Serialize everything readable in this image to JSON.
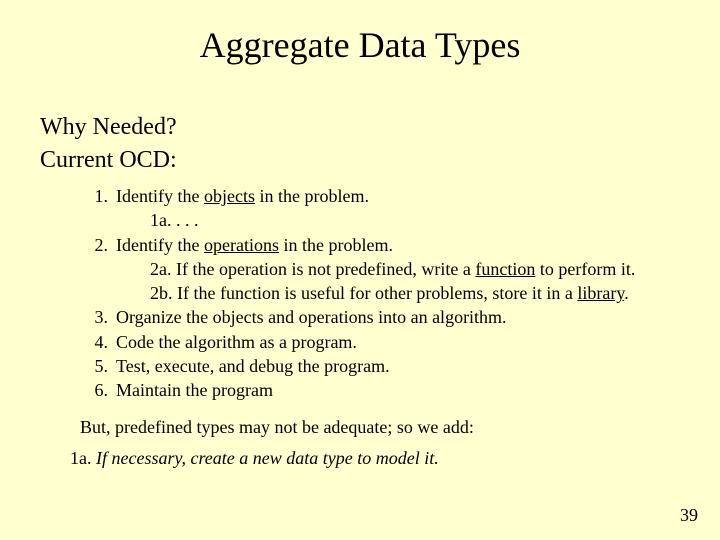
{
  "title": "Aggregate Data Types",
  "heading1": "Why Needed?",
  "heading2": "Current OCD:",
  "list": {
    "n1": "1.",
    "t1a": "Identify the ",
    "t1b_ul": "objects",
    "t1c": " in the problem.",
    "s1a": "1a.   .  .  .",
    "n2": "2.",
    "t2a": "Identify the ",
    "t2b_ul": "operations",
    "t2c": " in the problem.",
    "s2a_a": "2a.  If the operation is not predefined, write a ",
    "s2a_b_ul": "function",
    "s2a_c": " to perform it.",
    "s2b_a": "2b.  If the function is useful for other problems, store it in a ",
    "s2b_b_ul": "library",
    "s2b_c": ".",
    "n3": "3.",
    "t3": "Organize the objects and operations into an algorithm.",
    "n4": "4.",
    "t4": "Code the algorithm as a program.",
    "n5": "5.",
    "t5": "Test, execute, and debug the program.",
    "n6": "6.",
    "t6": "Maintain the program"
  },
  "closing": "But, predefined types may not be adequate; so we add:",
  "final_label": "1a. ",
  "final_italic": "If necessary, create a new data type to model it.",
  "page": "39"
}
